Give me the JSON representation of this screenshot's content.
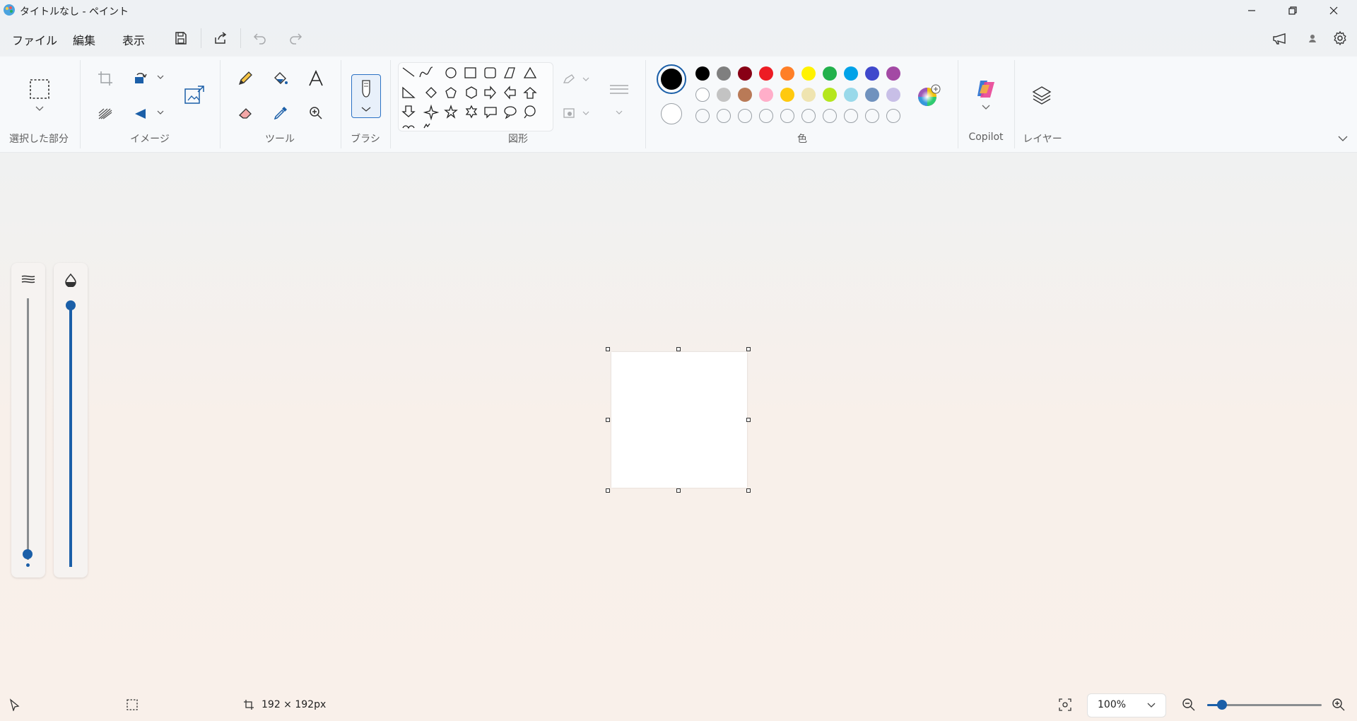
{
  "window": {
    "title": "タイトルなし - ペイント"
  },
  "menu": {
    "file": "ファイル",
    "edit": "編集",
    "view": "表示"
  },
  "ribbon": {
    "selection_label": "選択した部分",
    "image_label": "イメージ",
    "tools_label": "ツール",
    "brush_label": "ブラシ",
    "shapes_label": "図形",
    "colors_label": "色",
    "copilot_label": "Copilot",
    "layers_label": "レイヤー"
  },
  "colors": {
    "primary": "#000000",
    "secondary": "#ffffff",
    "row1": [
      "#000000",
      "#7f7f7f",
      "#880015",
      "#ed1c24",
      "#ff7f27",
      "#fff200",
      "#22b14c",
      "#00a2e8",
      "#3f48cc",
      "#a349a4"
    ],
    "row2": [
      "#ffffff",
      "#c3c3c3",
      "#b97a57",
      "#ffaec9",
      "#ffc90e",
      "#efe4b0",
      "#b5e61d",
      "#99d9ea",
      "#7092be",
      "#c8bfe7"
    ],
    "row3_empty_count": 10
  },
  "status": {
    "canvas_size": "192 × 192px",
    "zoom": "100%"
  }
}
